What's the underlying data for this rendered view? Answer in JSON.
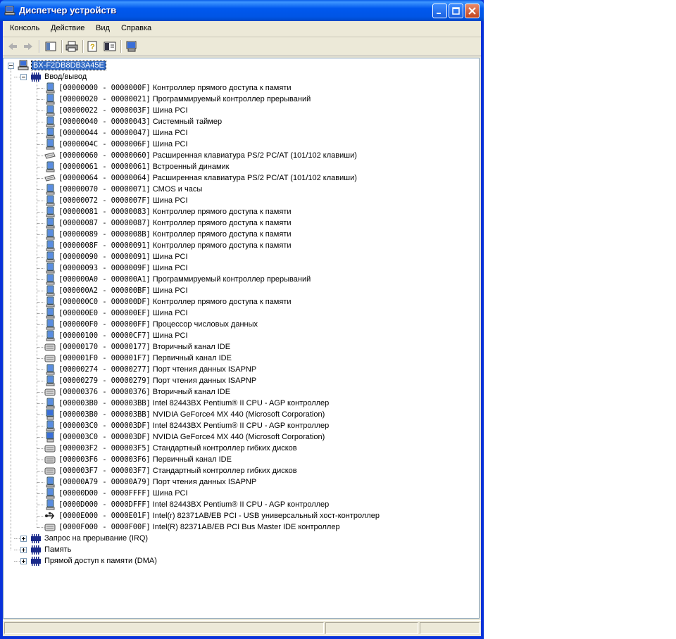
{
  "window": {
    "title": "Диспетчер устройств"
  },
  "menu": [
    "Консоль",
    "Действие",
    "Вид",
    "Справка"
  ],
  "tree": {
    "computer": "BX-F2DB8DB3A45E",
    "io_group": "Ввод/вывод",
    "io_items": [
      {
        "range": "[00000000 - 0000000F]",
        "name": "Контроллер прямого доступа к памяти",
        "icon": "system-device-icon"
      },
      {
        "range": "[00000020 - 00000021]",
        "name": "Программируемый контроллер прерываний",
        "icon": "system-device-icon"
      },
      {
        "range": "[00000022 - 0000003F]",
        "name": "Шина PCI",
        "icon": "system-device-icon"
      },
      {
        "range": "[00000040 - 00000043]",
        "name": "Системный таймер",
        "icon": "system-device-icon"
      },
      {
        "range": "[00000044 - 00000047]",
        "name": "Шина PCI",
        "icon": "system-device-icon"
      },
      {
        "range": "[0000004C - 0000006F]",
        "name": "Шина PCI",
        "icon": "system-device-icon"
      },
      {
        "range": "[00000060 - 00000060]",
        "name": "Расширенная клавиатура PS/2 PC/AT (101/102 клавиши)",
        "icon": "keyboard-icon"
      },
      {
        "range": "[00000061 - 00000061]",
        "name": "Встроенный динамик",
        "icon": "system-device-icon"
      },
      {
        "range": "[00000064 - 00000064]",
        "name": "Расширенная клавиатура PS/2 PC/AT (101/102 клавиши)",
        "icon": "keyboard-icon"
      },
      {
        "range": "[00000070 - 00000071]",
        "name": "CMOS и часы",
        "icon": "system-device-icon"
      },
      {
        "range": "[00000072 - 0000007F]",
        "name": "Шина PCI",
        "icon": "system-device-icon"
      },
      {
        "range": "[00000081 - 00000083]",
        "name": "Контроллер прямого доступа к памяти",
        "icon": "system-device-icon"
      },
      {
        "range": "[00000087 - 00000087]",
        "name": "Контроллер прямого доступа к памяти",
        "icon": "system-device-icon"
      },
      {
        "range": "[00000089 - 0000008B]",
        "name": "Контроллер прямого доступа к памяти",
        "icon": "system-device-icon"
      },
      {
        "range": "[0000008F - 00000091]",
        "name": "Контроллер прямого доступа к памяти",
        "icon": "system-device-icon"
      },
      {
        "range": "[00000090 - 00000091]",
        "name": "Шина PCI",
        "icon": "system-device-icon"
      },
      {
        "range": "[00000093 - 0000009F]",
        "name": "Шина PCI",
        "icon": "system-device-icon"
      },
      {
        "range": "[000000A0 - 000000A1]",
        "name": "Программируемый контроллер прерываний",
        "icon": "system-device-icon"
      },
      {
        "range": "[000000A2 - 000000BF]",
        "name": "Шина PCI",
        "icon": "system-device-icon"
      },
      {
        "range": "[000000C0 - 000000DF]",
        "name": "Контроллер прямого доступа к памяти",
        "icon": "system-device-icon"
      },
      {
        "range": "[000000E0 - 000000EF]",
        "name": "Шина PCI",
        "icon": "system-device-icon"
      },
      {
        "range": "[000000F0 - 000000FF]",
        "name": "Процессор числовых данных",
        "icon": "system-device-icon"
      },
      {
        "range": "[00000100 - 00000CF7]",
        "name": "Шина PCI",
        "icon": "system-device-icon"
      },
      {
        "range": "[00000170 - 00000177]",
        "name": "Вторичный канал IDE",
        "icon": "ide-controller-icon"
      },
      {
        "range": "[000001F0 - 000001F7]",
        "name": "Первичный канал IDE",
        "icon": "ide-controller-icon"
      },
      {
        "range": "[00000274 - 00000277]",
        "name": "Порт чтения данных ISAPNP",
        "icon": "system-device-icon"
      },
      {
        "range": "[00000279 - 00000279]",
        "name": "Порт чтения данных ISAPNP",
        "icon": "system-device-icon"
      },
      {
        "range": "[00000376 - 00000376]",
        "name": "Вторичный канал IDE",
        "icon": "ide-controller-icon"
      },
      {
        "range": "[000003B0 - 000003BB]",
        "name": "Intel 82443BX Pentium® II CPU - AGP контроллер",
        "icon": "system-device-icon"
      },
      {
        "range": "[000003B0 - 000003BB]",
        "name": "NVIDIA GeForce4 MX 440 (Microsoft Corporation)",
        "icon": "display-adapter-icon"
      },
      {
        "range": "[000003C0 - 000003DF]",
        "name": "Intel 82443BX Pentium® II CPU - AGP контроллер",
        "icon": "system-device-icon"
      },
      {
        "range": "[000003C0 - 000003DF]",
        "name": "NVIDIA GeForce4 MX 440 (Microsoft Corporation)",
        "icon": "display-adapter-icon"
      },
      {
        "range": "[000003F2 - 000003F5]",
        "name": "Стандартный контроллер гибких дисков",
        "icon": "ide-controller-icon"
      },
      {
        "range": "[000003F6 - 000003F6]",
        "name": "Первичный канал IDE",
        "icon": "ide-controller-icon"
      },
      {
        "range": "[000003F7 - 000003F7]",
        "name": "Стандартный контроллер гибких дисков",
        "icon": "ide-controller-icon"
      },
      {
        "range": "[00000A79 - 00000A79]",
        "name": "Порт чтения данных ISAPNP",
        "icon": "system-device-icon"
      },
      {
        "range": "[00000D00 - 0000FFFF]",
        "name": "Шина PCI",
        "icon": "system-device-icon"
      },
      {
        "range": "[0000D000 - 0000DFFF]",
        "name": "Intel 82443BX Pentium® II CPU - AGP контроллер",
        "icon": "system-device-icon"
      },
      {
        "range": "[0000E000 - 0000E01F]",
        "name": "Intel(r) 82371AB/EB PCI - USB универсальный хост-контроллер",
        "icon": "usb-icon"
      },
      {
        "range": "[0000F000 - 0000F00F]",
        "name": "Intel(R) 82371AB/EB PCI Bus Master IDE контроллер",
        "icon": "ide-controller-icon"
      }
    ],
    "other_groups": [
      "Запрос на прерывание (IRQ)",
      "Память",
      "Прямой доступ к памяти (DMA)"
    ]
  }
}
